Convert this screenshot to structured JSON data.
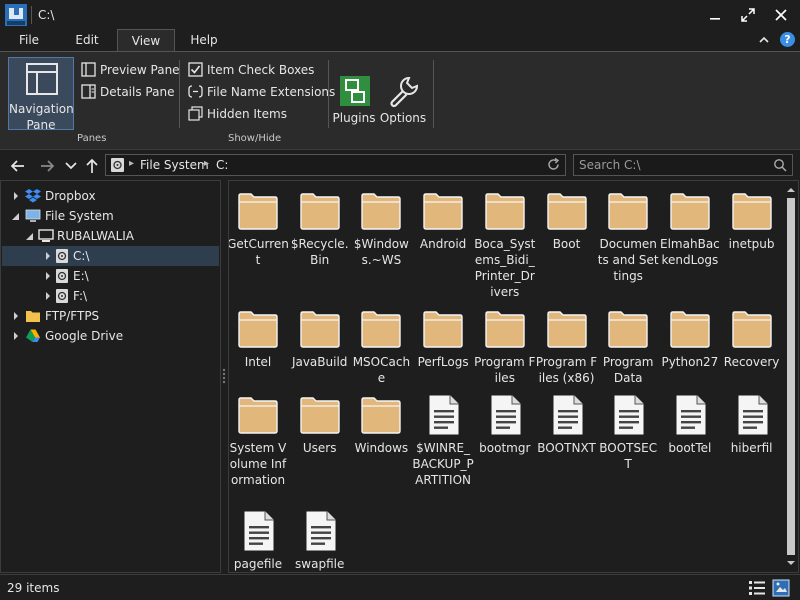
{
  "window": {
    "title": "C:\\"
  },
  "menu": {
    "tabs": [
      {
        "label": "File"
      },
      {
        "label": "Edit"
      },
      {
        "label": "View"
      },
      {
        "label": "Help"
      }
    ],
    "active": "View",
    "help_label": "?"
  },
  "ribbon": {
    "panes": {
      "navigation_pane": "Navigation Pane",
      "preview_pane": "Preview Pane",
      "details_pane": "Details Pane",
      "group_label": "Panes"
    },
    "show_hide": {
      "item_check_boxes": "Item Check Boxes",
      "file_name_extensions": "File Name Extensions",
      "hidden_items": "Hidden Items",
      "group_label": "Show/Hide"
    },
    "plugins": "Plugins",
    "options": "Options"
  },
  "address": {
    "crumbs": [
      "File System",
      "C:"
    ],
    "search_placeholder": "Search C:\\"
  },
  "tree": [
    {
      "label": "Dropbox",
      "icon": "dropbox-icon",
      "expander": "collapsed"
    },
    {
      "label": "File System",
      "icon": "computer-icon",
      "expander": "expanded"
    },
    {
      "label": "RUBALWALIA",
      "icon": "monitor-icon",
      "expander": "expanded"
    },
    {
      "label": "C:\\",
      "icon": "drive-icon",
      "expander": "collapsed",
      "selected": true
    },
    {
      "label": "E:\\",
      "icon": "drive-icon",
      "expander": "collapsed"
    },
    {
      "label": "F:\\",
      "icon": "drive-icon",
      "expander": "collapsed"
    },
    {
      "label": "FTP/FTPS",
      "icon": "folder-icon",
      "expander": "collapsed"
    },
    {
      "label": "Google Drive",
      "icon": "google-drive-icon",
      "expander": "collapsed"
    }
  ],
  "items": [
    {
      "name": "GetCurrent",
      "type": "folder"
    },
    {
      "name": "$Recycle.Bin",
      "type": "folder"
    },
    {
      "name": "$Windows.~WS",
      "type": "folder"
    },
    {
      "name": "Android",
      "type": "folder"
    },
    {
      "name": "Boca_Systems_Bidi_Printer_Drivers",
      "type": "folder"
    },
    {
      "name": "Boot",
      "type": "folder"
    },
    {
      "name": "Documents and Settings",
      "type": "folder"
    },
    {
      "name": "ElmahBackendLogs",
      "type": "folder"
    },
    {
      "name": "inetpub",
      "type": "folder"
    },
    {
      "name": "Intel",
      "type": "folder"
    },
    {
      "name": "JavaBuild",
      "type": "folder"
    },
    {
      "name": "MSOCache",
      "type": "folder"
    },
    {
      "name": "PerfLogs",
      "type": "folder"
    },
    {
      "name": "Program Files",
      "type": "folder"
    },
    {
      "name": "Program Files (x86)",
      "type": "folder"
    },
    {
      "name": "Program Data",
      "type": "folder"
    },
    {
      "name": "Python27",
      "type": "folder"
    },
    {
      "name": "Recovery",
      "type": "folder"
    },
    {
      "name": "System Volume Information",
      "type": "folder"
    },
    {
      "name": "Users",
      "type": "folder"
    },
    {
      "name": "Windows",
      "type": "folder"
    },
    {
      "name": "$WINRE_BACKUP_PARTITION",
      "type": "file"
    },
    {
      "name": "bootmgr",
      "type": "file"
    },
    {
      "name": "BOOTNXT",
      "type": "file"
    },
    {
      "name": "BOOTSECT",
      "type": "file"
    },
    {
      "name": "bootTel",
      "type": "file"
    },
    {
      "name": "hiberfil",
      "type": "file"
    },
    {
      "name": "pagefile",
      "type": "file"
    },
    {
      "name": "swapfile",
      "type": "file"
    }
  ],
  "status": {
    "count": "29 items"
  },
  "colors": {
    "folder": "#e2b77c",
    "accent": "#3a8ee6",
    "selection": "#2e3e4e"
  }
}
